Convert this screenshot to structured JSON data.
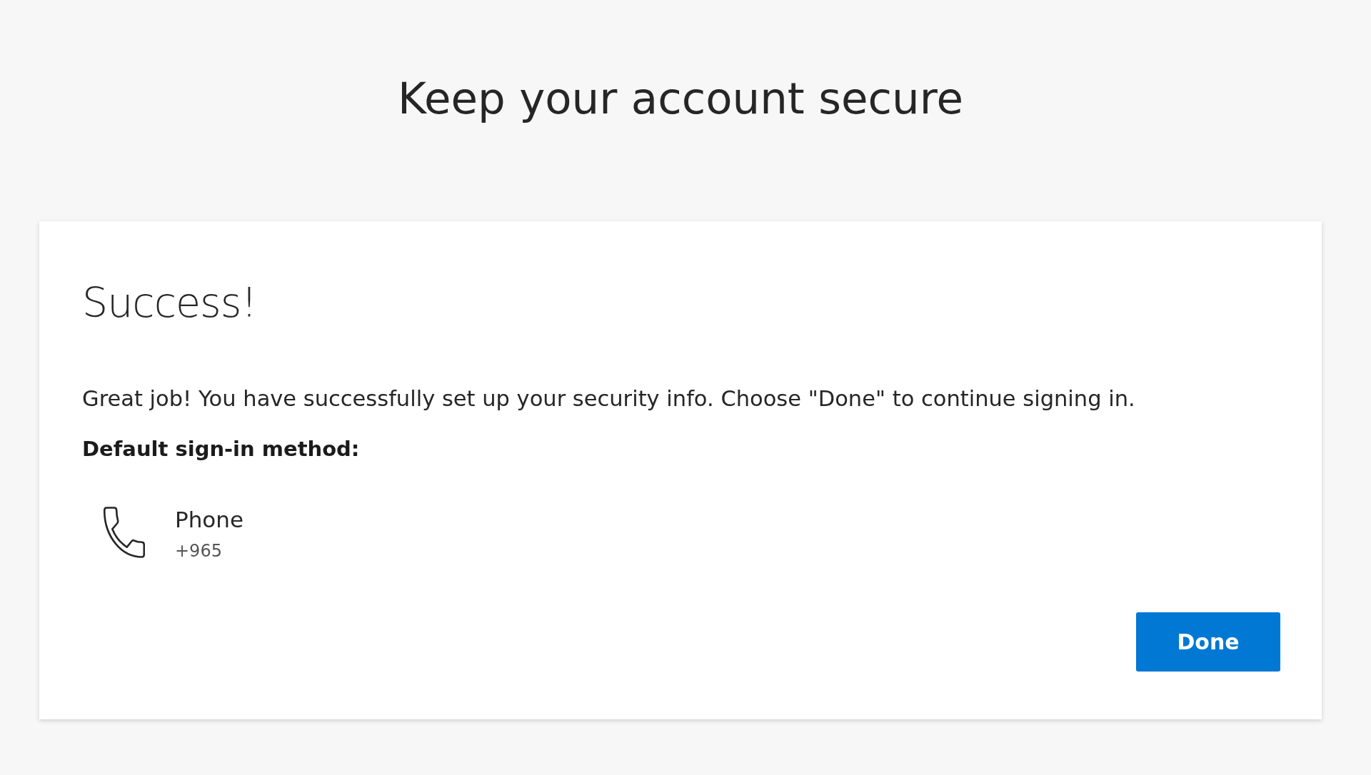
{
  "page": {
    "title": "Keep your account secure"
  },
  "card": {
    "heading": "Success!",
    "message": "Great job! You have successfully set up your security info. Choose \"Done\" to continue signing in.",
    "default_method_label": "Default sign-in method:",
    "methods": [
      {
        "kind": "phone",
        "name": "Phone",
        "detail": "+965"
      }
    ],
    "buttons": [
      {
        "kind": "primary",
        "label": "Done"
      }
    ]
  }
}
